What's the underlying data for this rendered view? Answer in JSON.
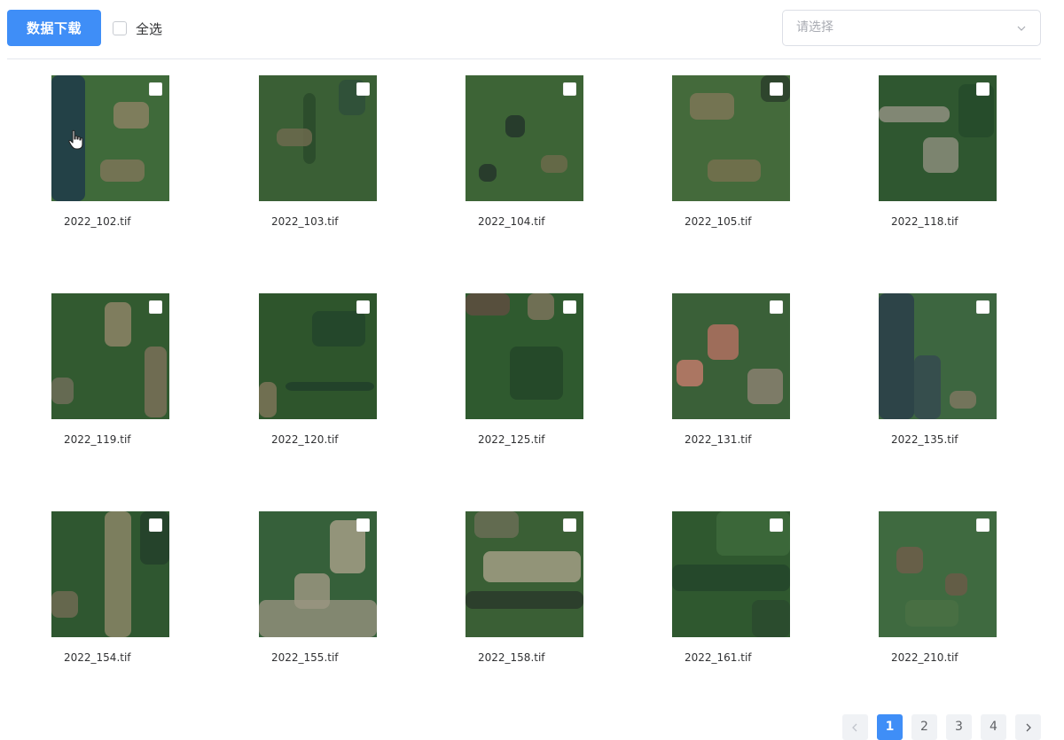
{
  "toolbar": {
    "download_label": "数据下载",
    "select_all_label": "全选",
    "dropdown_placeholder": "请选择",
    "accent_color": "#3f8ef7"
  },
  "tiles": [
    {
      "name": "2022_102.tif",
      "checked": false
    },
    {
      "name": "2022_103.tif",
      "checked": false
    },
    {
      "name": "2022_104.tif",
      "checked": false
    },
    {
      "name": "2022_105.tif",
      "checked": false
    },
    {
      "name": "2022_118.tif",
      "checked": false
    },
    {
      "name": "2022_119.tif",
      "checked": false
    },
    {
      "name": "2022_120.tif",
      "checked": false
    },
    {
      "name": "2022_125.tif",
      "checked": false
    },
    {
      "name": "2022_131.tif",
      "checked": false
    },
    {
      "name": "2022_135.tif",
      "checked": false
    },
    {
      "name": "2022_154.tif",
      "checked": false
    },
    {
      "name": "2022_155.tif",
      "checked": false
    },
    {
      "name": "2022_158.tif",
      "checked": false
    },
    {
      "name": "2022_161.tif",
      "checked": false
    },
    {
      "name": "2022_210.tif",
      "checked": false
    }
  ],
  "pagination": {
    "prev_icon": "chevron-left-icon",
    "next_icon": "chevron-right-icon",
    "pages": [
      "1",
      "2",
      "3",
      "4"
    ],
    "current": "1"
  }
}
